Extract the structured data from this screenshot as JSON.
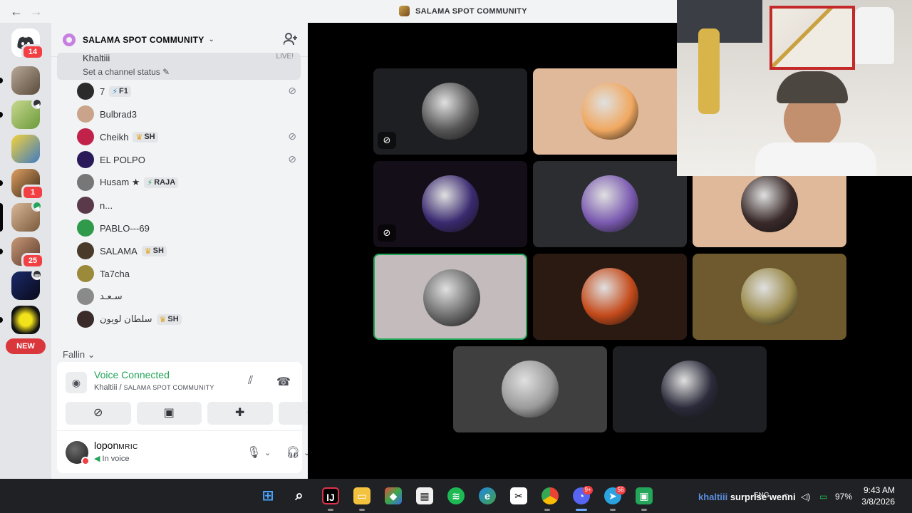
{
  "window": {
    "title": "SALAMA SPOT COMMUNITY",
    "back_icon": "←",
    "forward_icon": "→"
  },
  "rail": {
    "items": [
      {
        "name": "discord-home",
        "badge": "14",
        "color": "#ffffff"
      },
      {
        "name": "server-2",
        "badge": "",
        "color": "#8d7a6a"
      },
      {
        "name": "server-3",
        "badge": "",
        "color": "#a8c46a",
        "voice": true
      },
      {
        "name": "server-spongebob",
        "badge": "",
        "color": "#3e7bc4"
      },
      {
        "name": "server-5",
        "badge": "1",
        "color": "#a86a3a"
      },
      {
        "name": "server-6",
        "badge": "",
        "color": "#b08a6a",
        "voice": true
      },
      {
        "name": "server-7",
        "badge": "25",
        "color": "#9a6a4a"
      },
      {
        "name": "server-8",
        "badge": "",
        "color": "#121a3a",
        "event": true
      },
      {
        "name": "server-drip",
        "badge": "",
        "color": "#111111"
      }
    ],
    "new_label": "NEW"
  },
  "sidebar": {
    "server_name": "SALAMA SPOT COMMUNITY",
    "current_user": {
      "name": "Khaltiii",
      "status": "Set a channel status",
      "live": "LIVE!"
    },
    "members": [
      {
        "name": "7",
        "tag": "F1",
        "tag_icon": "⚡",
        "muted": true,
        "color": "#2b2b2b"
      },
      {
        "name": "Bulbrad3",
        "tag": "",
        "muted": false,
        "color": "#c9a48a"
      },
      {
        "name": "Cheikh",
        "tag": "SH",
        "tag_icon": "♛",
        "muted": true,
        "color": "#c0224a"
      },
      {
        "name": "EL POLPO",
        "tag": "",
        "muted": true,
        "color": "#2a1a5a"
      },
      {
        "name": "Husam ★",
        "tag": "RAJA",
        "tag_icon": "⚡",
        "muted": false,
        "color": "#777777"
      },
      {
        "name": "n...",
        "tag": "",
        "muted": false,
        "color": "#5a3a4a"
      },
      {
        "name": "PABLO---69",
        "tag": "",
        "muted": false,
        "color": "#2f9a4a"
      },
      {
        "name": "SALAMA",
        "tag": "SH",
        "tag_icon": "♛",
        "muted": false,
        "color": "#4a3a2a"
      },
      {
        "name": "Ta7cha",
        "tag": "",
        "muted": false,
        "color": "#9a8a3a"
      },
      {
        "name": "سـعـد",
        "tag": "",
        "muted": false,
        "color": "#8a8a8a"
      },
      {
        "name": "سلطان لويون",
        "tag": "SH",
        "tag_icon": "♛",
        "muted": false,
        "color": "#3a2a2a"
      }
    ],
    "category": "Fallin"
  },
  "voice": {
    "title": "Voice Connected",
    "channel": "Khaltiii",
    "server": "SALAMA SPOT COMMUNITY"
  },
  "user": {
    "name": "lopon",
    "name_suffix": "MRIC",
    "status": "In voice"
  },
  "stage": {
    "tiles": [
      {
        "name": "tile-1",
        "bg": "#1e1f22",
        "pic": "#555555",
        "muted": true
      },
      {
        "name": "tile-2",
        "bg": "#e0b89a",
        "pic": "#f0a860",
        "muted": false
      },
      {
        "name": "tile-3",
        "bg": "#140e18",
        "pic": "#3a2a70",
        "muted": true
      },
      {
        "name": "tile-4",
        "bg": "#2b2d31",
        "pic": "#7a5ab0",
        "muted": false
      },
      {
        "name": "tile-5",
        "bg": "#e0b89a",
        "pic": "#3a2a2a",
        "muted": false
      },
      {
        "name": "tile-6",
        "bg": "#c4bcbc",
        "pic": "#6a6a6a",
        "muted": false,
        "speaking": true
      },
      {
        "name": "tile-7",
        "bg": "#2a1a12",
        "pic": "#c44a1a",
        "muted": false
      },
      {
        "name": "tile-8",
        "bg": "#6e5a2e",
        "pic": "#9a8a4a",
        "muted": false
      },
      {
        "name": "tile-9",
        "bg": "#3f3f3f",
        "pic": "#9a9a9a",
        "muted": false
      },
      {
        "name": "tile-10",
        "bg": "#1e1f22",
        "pic": "#2a2a3a",
        "muted": false
      }
    ]
  },
  "taskbar": {
    "weather_user": "khaltiii",
    "weather_text": "surprise wenni",
    "lang": "ENG",
    "battery": "97%",
    "time": "9:43 AM",
    "date": "3/8/2026",
    "telegram_badge": "56",
    "discord_badge": "9+"
  }
}
